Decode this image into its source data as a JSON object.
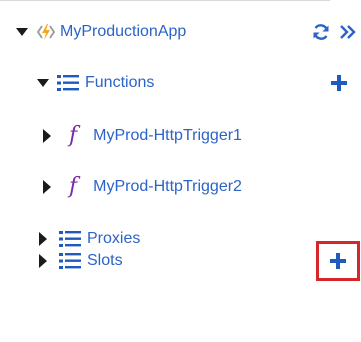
{
  "tree": {
    "app": {
      "label": "MyProductionApp",
      "icon": "function-app-icon",
      "actions": {
        "refresh_icon": "refresh-icon",
        "more_icon": "double-chevron-right-icon"
      }
    },
    "functions": {
      "label": "Functions",
      "icon": "list-icon",
      "add_icon": "plus-icon",
      "children": [
        {
          "label": "MyProd-HttpTrigger1",
          "icon": "function-f-icon",
          "glyph": "f"
        },
        {
          "label": "MyProd-HttpTrigger2",
          "icon": "function-f-icon",
          "glyph": "f"
        }
      ]
    },
    "proxies": {
      "label": "Proxies",
      "icon": "list-icon"
    },
    "slots": {
      "label": "Slots",
      "icon": "list-icon",
      "add_icon": "plus-icon"
    }
  },
  "colors": {
    "label": "#2b63c7",
    "plus": "#1e5bbd",
    "fx": "#7a2aa6",
    "app_icon": "#f2a81d",
    "highlight": "#d4262b"
  }
}
